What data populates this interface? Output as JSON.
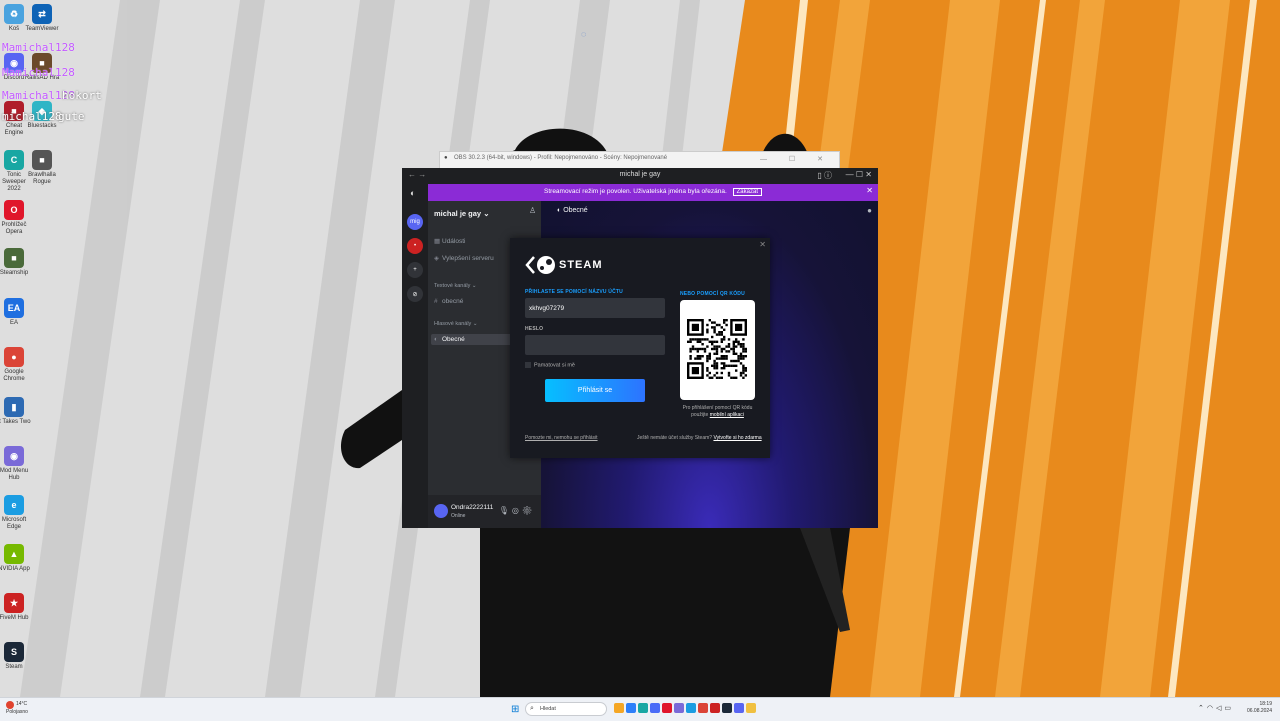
{
  "desktop": {
    "icons": [
      {
        "label": "Koš",
        "color": "#4aa3df",
        "glyph": "♻"
      },
      {
        "label": "TeamViewer",
        "color": "#0e63b6",
        "glyph": "⇄"
      },
      {
        "label": "Discord",
        "color": "#5865f2",
        "glyph": "◉"
      },
      {
        "label": "RallisAD Hra",
        "color": "#6b4a2a",
        "glyph": "■"
      },
      {
        "label": "Cheat Engine",
        "color": "#b01d2a",
        "glyph": "■"
      },
      {
        "label": "Bluestacks",
        "color": "#2fb5c6",
        "glyph": "◆"
      },
      {
        "label": "Tonic Sweeper 2022",
        "color": "#19a7a3",
        "glyph": "C"
      },
      {
        "label": "Brawlhalla Rogue",
        "color": "#555555",
        "glyph": "■"
      },
      {
        "label": "Prohlížeč Opera",
        "color": "#e0162b",
        "glyph": "O"
      },
      {
        "label": "Steamship",
        "color": "#4a6a3a",
        "glyph": "■"
      },
      {
        "label": "EA",
        "color": "#1f6fe0",
        "glyph": "EA"
      },
      {
        "label": "Google Chrome",
        "color": "#db4437",
        "glyph": "●"
      },
      {
        "label": "It Takes Two",
        "color": "#2d6ab3",
        "glyph": "▮"
      },
      {
        "label": "Mod Menu Hub",
        "color": "#7a6ad8",
        "glyph": "◉"
      },
      {
        "label": "Microsoft Edge",
        "color": "#1b9de2",
        "glyph": "e"
      },
      {
        "label": "NVIDIA App",
        "color": "#76b900",
        "glyph": "▲"
      },
      {
        "label": "FiveM Hub",
        "color": "#cc2222",
        "glyph": "★"
      },
      {
        "label": "Steam",
        "color": "#1b2838",
        "glyph": "S"
      }
    ],
    "overlay_names": [
      "Mamichal128",
      "Mamichal128",
      "Mamichal128",
      "michal128"
    ],
    "overlay_words": [
      "hokort",
      "gute"
    ]
  },
  "obs": {
    "title": "OBS 30.2.3 (64-bit, windows) - Profil: Nepojmenováno - Scény: Nepojmenované"
  },
  "discord": {
    "window_title": "michal je gay",
    "banner": {
      "message": "Streamovací režim je povolen. Uživatelská jména byla ořezána.",
      "button": "Zakázat"
    },
    "guilds": [
      {
        "label": "mig",
        "color": "#5865f2"
      },
      {
        "label": "•",
        "color": "#cc2222"
      },
      {
        "label": "+",
        "color": "#313338"
      },
      {
        "label": "⊘",
        "color": "#313338"
      }
    ],
    "server_name": "michal je gay ⌄",
    "channels": {
      "events": "Události",
      "boost": "Vylepšení serveru",
      "text_category": "Textové kanály",
      "text_channel": "obecné",
      "voice_category": "Hlasové kanály",
      "voice_channel": "Obecné"
    },
    "user": {
      "name": "Ondra2222111",
      "status": "Online"
    },
    "main_header": "Obecné"
  },
  "steam": {
    "brand": "STEAM",
    "account_label": "PŘIHLASTE SE POMOCÍ NÁZVU ÚČTU",
    "account_value": "xkhvg07279",
    "password_label": "HESLO",
    "password_value": "",
    "remember_label": "Pamatovat si mě",
    "signin_button": "Přihlásit se",
    "help_link": "Pomozte mi, nemohu se přihlásit",
    "qr_label": "NEBO POMOCÍ QR KÓDU",
    "qr_help_prefix": "Pro přihlášení pomocí QR kódu použijte",
    "qr_help_link": "mobilní aplikaci",
    "no_account": "Ještě nemáte účet služby Steam?",
    "create_link": "Vytvořte si ho zdarma"
  },
  "taskbar": {
    "weather_temp": "14°C",
    "weather_desc": "Polojasno",
    "search_placeholder": "Hledat",
    "time": "18:19",
    "date": "06.08.2024",
    "apps": [
      "#f5a623",
      "#2d7ff9",
      "#19a7a3",
      "#4a6cf7",
      "#e0162b",
      "#7a6ad8",
      "#1b9de2",
      "#db4437",
      "#cc2222",
      "#1b2838",
      "#5865f2",
      "#f0c040"
    ]
  }
}
